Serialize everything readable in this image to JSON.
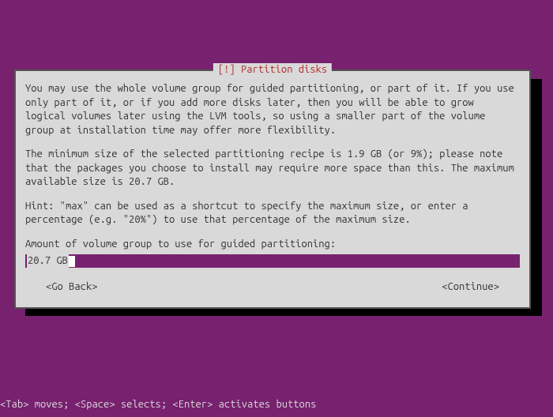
{
  "dialog": {
    "title": "[!] Partition disks",
    "paragraphs": [
      "You may use the whole volume group for guided partitioning, or part of it. If you use only part of it, or if you add more disks later, then you will be able to grow logical volumes later using the LVM tools, so using a smaller part of the volume group at installation time may offer more flexibility.",
      "The minimum size of the selected partitioning recipe is 1.9 GB (or 9%); please note that the packages you choose to install may require more space than this. The maximum available size is 20.7 GB.",
      "Hint: \"max\" can be used as a shortcut to specify the maximum size, or enter a percentage (e.g. \"20%\") to use that percentage of the maximum size."
    ],
    "prompt_label": "Amount of volume group to use for guided partitioning:",
    "input_value": "20.7 GB",
    "go_back_label": "<Go Back>",
    "continue_label": "<Continue>"
  },
  "footer": {
    "hint": "<Tab> moves; <Space> selects; <Enter> activates buttons"
  }
}
